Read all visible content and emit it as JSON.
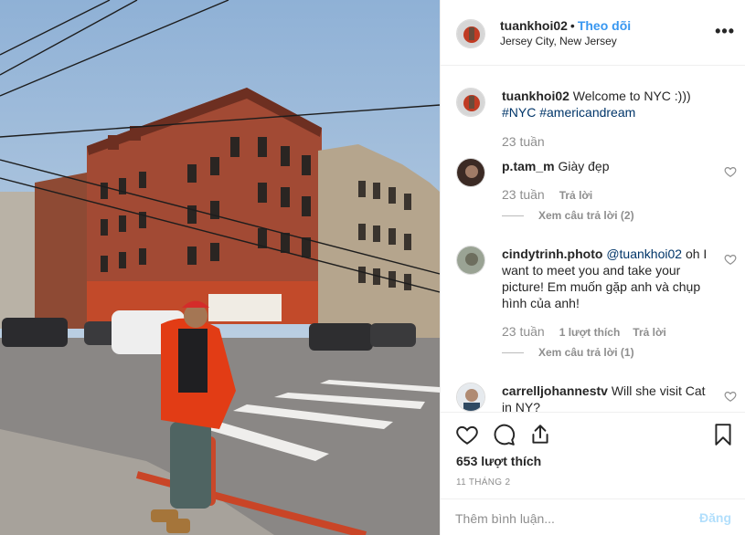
{
  "post": {
    "author": "tuankhoi02",
    "separator": "•",
    "follow_label": "Theo dõi",
    "location": "Jersey City, New Jersey",
    "more_label": "•••",
    "photo_subject": "man-in-red-jacket-on-street-corner"
  },
  "caption": {
    "user": "tuankhoi02",
    "text": "Welcome to NYC :)))",
    "tags": "#NYC #americandream",
    "time": "23 tuần"
  },
  "comments": [
    {
      "user": "p.tam_m",
      "text": "Giày đẹp",
      "time": "23 tuần",
      "reply_label": "Trả lời",
      "view_replies": "Xem câu trả lời (2)"
    },
    {
      "user": "cindytrinh.photo",
      "mention": "@tuankhoi02",
      "text": "oh I want to meet you and take your picture! Em muốn gặp anh và chụp hình của anh!",
      "time": "23 tuần",
      "likes_label": "1 lượt thích",
      "reply_label": "Trả lời",
      "view_replies": "Xem câu trả lời (1)"
    },
    {
      "user": "carrelljohannestv",
      "text": "Will she visit Cat in NY?"
    }
  ],
  "actions": {
    "like_icon": "heart-icon",
    "comment_icon": "comment-icon",
    "share_icon": "share-icon",
    "save_icon": "bookmark-icon",
    "likes_count": "653 lượt thích",
    "date": "11 THÁNG 2"
  },
  "composer": {
    "placeholder": "Thêm bình luận...",
    "post_label": "Đăng"
  },
  "colors": {
    "link": "#3897f0",
    "hashtag": "#003569",
    "muted": "#8e8e8e",
    "post_disabled": "#b2dffc"
  }
}
